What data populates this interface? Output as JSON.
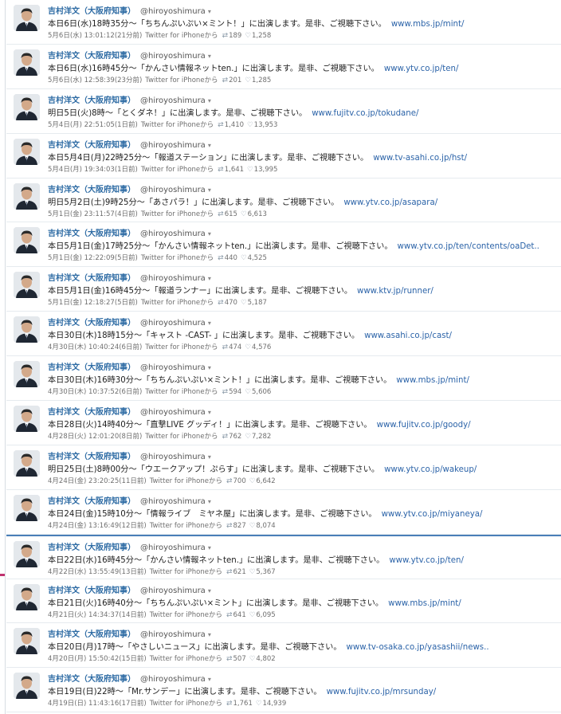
{
  "tweets": [
    {
      "name": "吉村洋文（大阪府知事）",
      "handle": "@hiroyoshimura",
      "text": "本日6日(水)18時35分～「ちちんぷいぷい×ミント！」に出演します。是非、ご視聴下さい。",
      "link": "www.mbs.jp/mint/",
      "time": "5月6日(水) 13:01:12(21分前)",
      "source": "Twitter for iPhoneから",
      "retweets": "189",
      "likes": "1,258"
    },
    {
      "name": "吉村洋文（大阪府知事）",
      "handle": "@hiroyoshimura",
      "text": "本日6日(水)16時45分～「かんさい情報ネットten.」に出演します。是非、ご視聴下さい。",
      "link": "www.ytv.co.jp/ten/",
      "time": "5月6日(水) 12:58:39(23分前)",
      "source": "Twitter for iPhoneから",
      "retweets": "201",
      "likes": "1,285"
    },
    {
      "name": "吉村洋文（大阪府知事）",
      "handle": "@hiroyoshimura",
      "text": "明日5日(火)8時～「とくダネ！」に出演します。是非、ご視聴下さい。",
      "link": "www.fujitv.co.jp/tokudane/",
      "time": "5月4日(月) 22:51:05(1日前)",
      "source": "Twitter for iPhoneから",
      "retweets": "1,410",
      "likes": "13,953"
    },
    {
      "name": "吉村洋文（大阪府知事）",
      "handle": "@hiroyoshimura",
      "text": "本日5月4日(月)22時25分～「報道ステーション」に出演します。是非、ご視聴下さい。",
      "link": "www.tv-asahi.co.jp/hst/",
      "time": "5月4日(月) 19:34:03(1日前)",
      "source": "Twitter for iPhoneから",
      "retweets": "1,641",
      "likes": "13,995"
    },
    {
      "name": "吉村洋文（大阪府知事）",
      "handle": "@hiroyoshimura",
      "text": "明日5月2日(土)9時25分～「あさパラ！」に出演します。是非、ご視聴下さい。",
      "link": "www.ytv.co.jp/asapara/",
      "time": "5月1日(金) 23:11:57(4日前)",
      "source": "Twitter for iPhoneから",
      "retweets": "615",
      "likes": "6,613"
    },
    {
      "name": "吉村洋文（大阪府知事）",
      "handle": "@hiroyoshimura",
      "text": "本日5月1日(金)17時25分～「かんさい情報ネットten.」に出演します。是非、ご視聴下さい。",
      "link": "www.ytv.co.jp/ten/contents/oaDet..",
      "time": "5月1日(金) 12:22:09(5日前)",
      "source": "Twitter for iPhoneから",
      "retweets": "440",
      "likes": "4,525"
    },
    {
      "name": "吉村洋文（大阪府知事）",
      "handle": "@hiroyoshimura",
      "text": "本日5月1日(金)16時45分～「報道ランナー」に出演します。是非、ご視聴下さい。",
      "link": "www.ktv.jp/runner/",
      "time": "5月1日(金) 12:18:27(5日前)",
      "source": "Twitter for iPhoneから",
      "retweets": "470",
      "likes": "5,187"
    },
    {
      "name": "吉村洋文（大阪府知事）",
      "handle": "@hiroyoshimura",
      "text": "本日30日(木)18時15分～「キャスト -CAST- 」に出演します。是非、ご視聴下さい。",
      "link": "www.asahi.co.jp/cast/",
      "time": "4月30日(木) 10:40:24(6日前)",
      "source": "Twitter for iPhoneから",
      "retweets": "474",
      "likes": "4,576"
    },
    {
      "name": "吉村洋文（大阪府知事）",
      "handle": "@hiroyoshimura",
      "text": "本日30日(木)16時30分～「ちちんぷいぷい×ミント！」に出演します。是非、ご視聴下さい。",
      "link": "www.mbs.jp/mint/",
      "time": "4月30日(木) 10:37:52(6日前)",
      "source": "Twitter for iPhoneから",
      "retweets": "594",
      "likes": "5,606"
    },
    {
      "name": "吉村洋文（大阪府知事）",
      "handle": "@hiroyoshimura",
      "text": "本日28日(火)14時40分～「直撃LIVE グッディ！」に出演します。是非、ご視聴下さい。",
      "link": "www.fujitv.co.jp/goody/",
      "time": "4月28日(火) 12:01:20(8日前)",
      "source": "Twitter for iPhoneから",
      "retweets": "762",
      "likes": "7,282"
    },
    {
      "name": "吉村洋文（大阪府知事）",
      "handle": "@hiroyoshimura",
      "text": "明日25日(土)8時00分～「ウエークアップ！ぷらす」に出演します。是非、ご視聴下さい。",
      "link": "www.ytv.co.jp/wakeup/",
      "time": "4月24日(金) 23:20:25(11日前)",
      "source": "Twitter for iPhoneから",
      "retweets": "700",
      "likes": "6,642"
    },
    {
      "name": "吉村洋文（大阪府知事）",
      "handle": "@hiroyoshimura",
      "text": "本日24日(金)15時10分～「情報ライブ　ミヤネ屋」に出演します。是非、ご視聴下さい。",
      "link": "www.ytv.co.jp/miyaneya/",
      "time": "4月24日(金) 13:16:49(12日前)",
      "source": "Twitter for iPhoneから",
      "retweets": "827",
      "likes": "8,074"
    },
    {
      "name": "吉村洋文（大阪府知事）",
      "handle": "@hiroyoshimura",
      "text": "本日22日(水)16時45分～「かんさい情報ネットten.」に出演します。是非、ご視聴下さい。",
      "link": "www.ytv.co.jp/ten/",
      "time": "4月22日(水) 13:55:49(13日前)",
      "source": "Twitter for iPhoneから",
      "retweets": "621",
      "likes": "5,367"
    },
    {
      "name": "吉村洋文（大阪府知事）",
      "handle": "@hiroyoshimura",
      "text": "本日21日(火)16時40分～「ちちんぷいぷい×ミント」に出演します。是非、ご視聴下さい。",
      "link": "www.mbs.jp/mint/",
      "time": "4月21日(火) 14:34:37(14日前)",
      "source": "Twitter for iPhoneから",
      "retweets": "641",
      "likes": "6,095"
    },
    {
      "name": "吉村洋文（大阪府知事）",
      "handle": "@hiroyoshimura",
      "text": "本日20日(月)17時～「やさしいニュース」に出演します。是非、ご視聴下さい。",
      "link": "www.tv-osaka.co.jp/yasashii/news..",
      "time": "4月20日(月) 15:50:42(15日前)",
      "source": "Twitter for iPhoneから",
      "retweets": "507",
      "likes": "4,802"
    },
    {
      "name": "吉村洋文（大阪府知事）",
      "handle": "@hiroyoshimura",
      "text": "本日19日(日)22時～「Mr.サンデー」に出演します。是非、ご視聴下さい。",
      "link": "www.fujitv.co.jp/mrsunday/",
      "time": "4月19日(日) 11:43:16(17日前)",
      "source": "Twitter for iPhoneから",
      "retweets": "1,761",
      "likes": "14,939"
    }
  ],
  "icons": {
    "caret": "▾",
    "retweet": "⇄",
    "heart": "♡"
  },
  "colors": {
    "name": "#2c6aa3",
    "link": "#2b63a8",
    "meta": "#6f6f6f",
    "divider": "#4a7fb8",
    "accent": "#c0326e"
  }
}
